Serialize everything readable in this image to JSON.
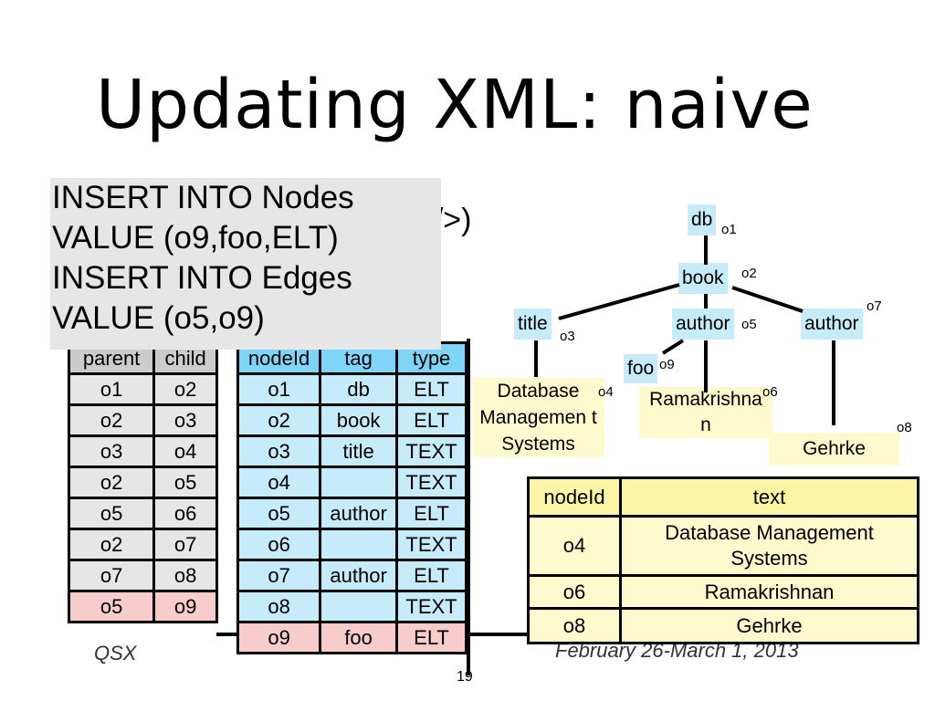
{
  "slide": {
    "title": "Updating XML: naive",
    "background_code": "oo/>)",
    "footer_left": "QSX",
    "footer_date": "February 26-March 1, 2013",
    "page_number": "19"
  },
  "sql": {
    "lines": [
      "INSERT INTO Nodes",
      "VALUE (o9,foo,ELT)",
      "INSERT INTO Edges",
      "VALUE (o5,o9)"
    ]
  },
  "edges_table": {
    "headers": [
      "parent",
      "child"
    ],
    "rows": [
      {
        "parent": "o1",
        "child": "o2",
        "new": false
      },
      {
        "parent": "o2",
        "child": "o3",
        "new": false
      },
      {
        "parent": "o3",
        "child": "o4",
        "new": false
      },
      {
        "parent": "o2",
        "child": "o5",
        "new": false
      },
      {
        "parent": "o5",
        "child": "o6",
        "new": false
      },
      {
        "parent": "o2",
        "child": "o7",
        "new": false
      },
      {
        "parent": "o7",
        "child": "o8",
        "new": false
      },
      {
        "parent": "o5",
        "child": "o9",
        "new": true
      }
    ]
  },
  "nodes_table": {
    "headers": [
      "nodeId",
      "tag",
      "type"
    ],
    "rows": [
      {
        "nodeId": "o1",
        "tag": "db",
        "type": "ELT",
        "new": false
      },
      {
        "nodeId": "o2",
        "tag": "book",
        "type": "ELT",
        "new": false
      },
      {
        "nodeId": "o3",
        "tag": "title",
        "type": "TEXT",
        "new": false
      },
      {
        "nodeId": "o4",
        "tag": "",
        "type": "TEXT",
        "new": false
      },
      {
        "nodeId": "o5",
        "tag": "author",
        "type": "ELT",
        "new": false
      },
      {
        "nodeId": "o6",
        "tag": "",
        "type": "TEXT",
        "new": false
      },
      {
        "nodeId": "o7",
        "tag": "author",
        "type": "ELT",
        "new": false
      },
      {
        "nodeId": "o8",
        "tag": "",
        "type": "TEXT",
        "new": false
      },
      {
        "nodeId": "o9",
        "tag": "foo",
        "type": "ELT",
        "new": true
      }
    ]
  },
  "text_table": {
    "headers": [
      "nodeId",
      "text"
    ],
    "rows": [
      {
        "nodeId": "o4",
        "text": "Database Management Systems"
      },
      {
        "nodeId": "o6",
        "text": "Ramakrishnan"
      },
      {
        "nodeId": "o8",
        "text": "Gehrke"
      }
    ]
  },
  "tree": {
    "nodes": [
      {
        "id": "o1",
        "label": "db",
        "kind": "element"
      },
      {
        "id": "o2",
        "label": "book",
        "kind": "element"
      },
      {
        "id": "o3",
        "label": "title",
        "kind": "element"
      },
      {
        "id": "o5",
        "label": "author",
        "kind": "element"
      },
      {
        "id": "o7",
        "label": "author",
        "kind": "element"
      },
      {
        "id": "o9",
        "label": "foo",
        "kind": "element"
      },
      {
        "id": "o4",
        "label": "Database Managemen t Systems",
        "kind": "text"
      },
      {
        "id": "o6",
        "label": "Ramakrishna n",
        "kind": "text"
      },
      {
        "id": "o8",
        "label": "Gehrke",
        "kind": "text"
      }
    ]
  },
  "colors": {
    "edges_header": "#cccccc",
    "edges_cell": "#e6e6e6",
    "nodes_header": "#7fd5f7",
    "nodes_cell": "#c6ecfb",
    "text_header": "#fbf5a5",
    "text_cell": "#fdfacd",
    "inserted_row": "#f9cccc"
  }
}
